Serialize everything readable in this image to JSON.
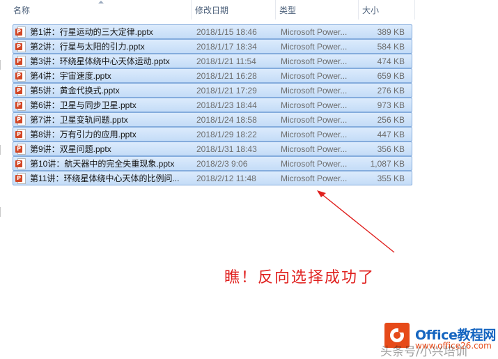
{
  "columns": {
    "name": "名称",
    "date": "修改日期",
    "type": "类型",
    "size": "大小"
  },
  "files": [
    {
      "name": "第1讲：行星运动的三大定律.pptx",
      "date": "2018/1/15 18:46",
      "type": "Microsoft Power...",
      "size": "389 KB"
    },
    {
      "name": "第2讲：行星与太阳的引力.pptx",
      "date": "2018/1/17 18:34",
      "type": "Microsoft Power...",
      "size": "584 KB"
    },
    {
      "name": "第3讲：环绕星体绕中心天体运动.pptx",
      "date": "2018/1/21 11:54",
      "type": "Microsoft Power...",
      "size": "474 KB"
    },
    {
      "name": "第4讲：宇宙速度.pptx",
      "date": "2018/1/21 16:28",
      "type": "Microsoft Power...",
      "size": "659 KB"
    },
    {
      "name": "第5讲：黄金代换式.pptx",
      "date": "2018/1/21 17:29",
      "type": "Microsoft Power...",
      "size": "276 KB"
    },
    {
      "name": "第6讲：卫星与同步卫星.pptx",
      "date": "2018/1/23 18:44",
      "type": "Microsoft Power...",
      "size": "973 KB"
    },
    {
      "name": "第7讲：卫星变轨问题.pptx",
      "date": "2018/1/24 18:58",
      "type": "Microsoft Power...",
      "size": "256 KB"
    },
    {
      "name": "第8讲：万有引力的应用.pptx",
      "date": "2018/1/29 18:22",
      "type": "Microsoft Power...",
      "size": "447 KB"
    },
    {
      "name": "第9讲：双星问题.pptx",
      "date": "2018/1/31 18:43",
      "type": "Microsoft Power...",
      "size": "356 KB"
    },
    {
      "name": "第10讲：航天器中的完全失重现象.pptx",
      "date": "2018/2/3 9:06",
      "type": "Microsoft Power...",
      "size": "1,087 KB"
    },
    {
      "name": "第11讲：环绕星体绕中心天体的比例问...",
      "date": "2018/2/12 11:48",
      "type": "Microsoft Power...",
      "size": "355 KB"
    }
  ],
  "icon": {
    "name": "powerpoint-file-icon",
    "letter": "P",
    "color": "#d24726"
  },
  "annotation": {
    "text": "瞧！反向选择成功了",
    "color": "#e0201e"
  },
  "watermark": {
    "brand": "Office教程网",
    "url": "www.office26.com",
    "faint": "头条号/小兴培训"
  },
  "colors": {
    "selection_fill": "#c4dcf7",
    "selection_border": "#84acdd",
    "header_text": "#4c607a"
  }
}
